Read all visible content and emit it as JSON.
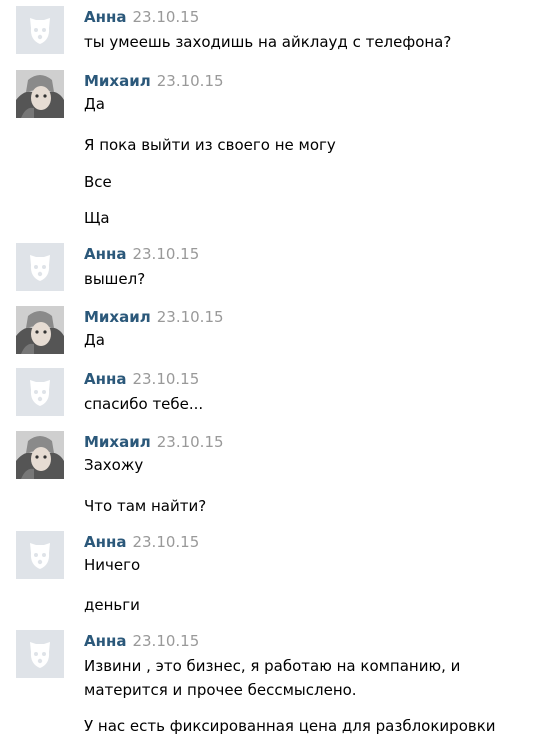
{
  "chat": {
    "groups": [
      {
        "author": "Анна",
        "date": "23.10.15",
        "avatar": "anna-default-dog-avatar",
        "lines": [
          "ты умеешь заходишь на айклауд с телефона?"
        ]
      },
      {
        "author": "Михаил",
        "date": "23.10.15",
        "avatar": "mikhail-photo-avatar",
        "lines": [
          "Да",
          "Я пока выйти из своего не могу",
          "Все",
          "Ща"
        ]
      },
      {
        "author": "Анна",
        "date": "23.10.15",
        "avatar": "anna-default-dog-avatar",
        "lines": [
          "вышел?"
        ]
      },
      {
        "author": "Михаил",
        "date": "23.10.15",
        "avatar": "mikhail-photo-avatar",
        "lines": [
          "Да"
        ]
      },
      {
        "author": "Анна",
        "date": "23.10.15",
        "avatar": "anna-default-dog-avatar",
        "lines": [
          "спасибо тебе..."
        ]
      },
      {
        "author": "Михаил",
        "date": "23.10.15",
        "avatar": "mikhail-photo-avatar",
        "lines": [
          "Захожу",
          "Что там найти?"
        ]
      },
      {
        "author": "Анна",
        "date": "23.10.15",
        "avatar": "anna-default-dog-avatar",
        "lines": [
          "Ничего",
          "деньги"
        ]
      },
      {
        "author": "Анна",
        "date": "23.10.15",
        "avatar": "anna-default-dog-avatar",
        "lines": [
          "Извини , это бизнес, я работаю на компанию, и матерится и прочее бессмыслено.",
          "У нас есть фиксированная цена для разблокировки"
        ]
      }
    ]
  },
  "colors": {
    "author": "#2b587a",
    "date": "#999999",
    "text": "#000000",
    "default_avatar_bg": "#dfe3e8"
  }
}
